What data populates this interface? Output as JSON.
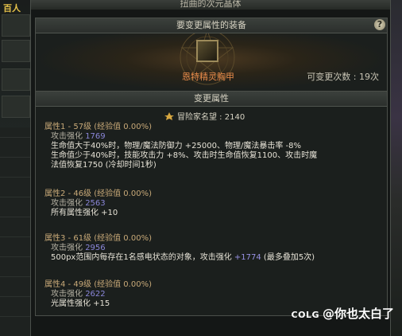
{
  "window": {
    "title": "扭曲的次元晶体"
  },
  "equip_panel": {
    "header": "要变更属性的装备",
    "item_name": "恩特精灵胸甲",
    "change_label": "可变更次数 : 19次",
    "help_label": "?"
  },
  "attr_panel": {
    "header": "变更属性",
    "fame": "冒险家名望 : 2140",
    "attributes": [
      {
        "title": "属性1 - 57级 (经验值 0.00%)",
        "sub_label": "攻击强化",
        "sub_value": "1769",
        "lines": [
          "生命值大于40%时，物理/魔法防御力 +25000、物理/魔法暴击率 -8%",
          "生命值少于40%时，技能攻击力 +8%、攻击时生命值恢复1100、攻击时魔",
          "法值恢复1750 (冷却时间1秒)"
        ]
      },
      {
        "title": "属性2 - 46级 (经验值 0.00%)",
        "sub_label": "攻击强化",
        "sub_value": "2563",
        "lines": [
          "所有属性强化 +10"
        ]
      },
      {
        "title": "属性3 - 61级 (经验值 0.00%)",
        "sub_label": "攻击强化",
        "sub_value": "2956",
        "line_pre": "500px范围内每存在1名感电状态的对象，攻击强化",
        "line_value": "+1774",
        "line_post": "(最多叠加5次)"
      },
      {
        "title": "属性4 - 49级 (经验值 0.00%)",
        "sub_label": "攻击强化",
        "sub_value": "2622",
        "lines": [
          "光属性强化 +15"
        ]
      }
    ]
  },
  "left_strip": {
    "text": "百人"
  },
  "watermark": {
    "logo": "COLG",
    "text": "@你也太白了"
  }
}
